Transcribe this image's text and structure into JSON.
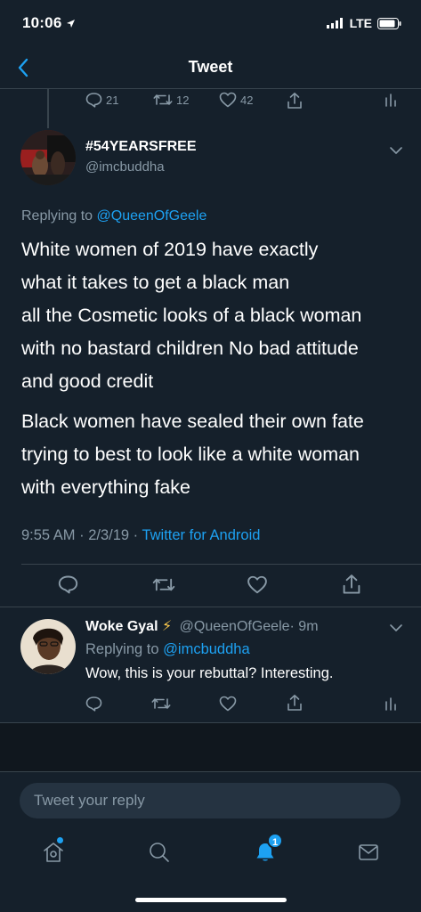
{
  "status_bar": {
    "time": "10:06",
    "network": "LTE"
  },
  "header": {
    "title": "Tweet"
  },
  "previous_tweet": {
    "replies": "21",
    "retweets": "12",
    "likes": "42"
  },
  "main_tweet": {
    "display_name": "#54YEARSFREE",
    "handle": "@imcbuddha",
    "replying_prefix": "Replying to",
    "replying_to": "@QueenOfGeele",
    "lines": [
      "White women of 2019 have exactly",
      "what it takes to get a black man",
      "all the Cosmetic looks of a black woman",
      "with no bastard children No bad attitude",
      "and good credit",
      "Black women have sealed their own fate",
      "trying to best to look like a white woman",
      "with everything fake"
    ],
    "timestamp": "9:55 AM · 2/3/19 ·",
    "source": "Twitter for Android"
  },
  "reply_tweet": {
    "display_name": "Woke Gyal",
    "name_emoji": "⚡",
    "handle": "@QueenOfGeele",
    "time": "· 9m",
    "replying_prefix": "Replying to",
    "replying_to": "@imcbuddha",
    "text": "Wow, this is your rebuttal? Interesting."
  },
  "compose": {
    "placeholder": "Tweet your reply"
  },
  "tabbar": {
    "notifications_badge": "1"
  },
  "colors": {
    "background": "#15202b",
    "accent": "#1da1f2",
    "muted": "#8899a6",
    "border": "#38444d"
  }
}
